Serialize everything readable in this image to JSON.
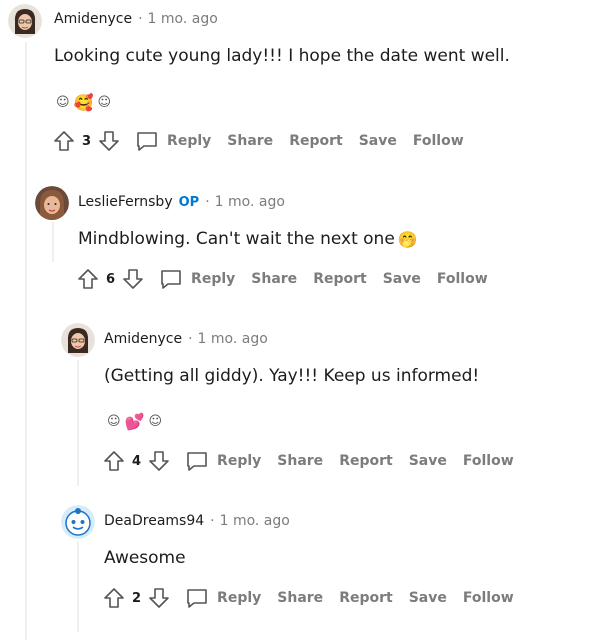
{
  "comments": [
    {
      "username": "Amidenyce",
      "op": "",
      "sep": "·",
      "age": "1 mo. ago",
      "body": "Looking cute young lady!!! I hope the date went well.",
      "emojis": [
        "☺",
        "🥰",
        "☺"
      ],
      "score": "3",
      "actions": {
        "reply": "Reply",
        "share": "Share",
        "report": "Report",
        "save": "Save",
        "follow": "Follow"
      }
    },
    {
      "username": "LeslieFernsby",
      "op": "OP",
      "sep": "·",
      "age": "1 mo. ago",
      "body": "Mindblowing. Can't wait the next one",
      "body_emoji": "🤭",
      "score": "6",
      "actions": {
        "reply": "Reply",
        "share": "Share",
        "report": "Report",
        "save": "Save",
        "follow": "Follow"
      }
    },
    {
      "username": "Amidenyce",
      "op": "",
      "sep": "·",
      "age": "1 mo. ago",
      "body": "(Getting all giddy). Yay!!! Keep us informed!",
      "emojis": [
        "☺",
        "💕",
        "☺"
      ],
      "score": "4",
      "actions": {
        "reply": "Reply",
        "share": "Share",
        "report": "Report",
        "save": "Save",
        "follow": "Follow"
      }
    },
    {
      "username": "DeaDreams94",
      "op": "",
      "sep": "·",
      "age": "1 mo. ago",
      "body": "Awesome",
      "score": "2",
      "actions": {
        "reply": "Reply",
        "share": "Share",
        "report": "Report",
        "save": "Save",
        "follow": "Follow"
      }
    }
  ],
  "colors": {
    "op": "#0079d3",
    "muted": "#7c7c7c",
    "text": "#1c1c1c",
    "thread_line": "#edeff1"
  }
}
